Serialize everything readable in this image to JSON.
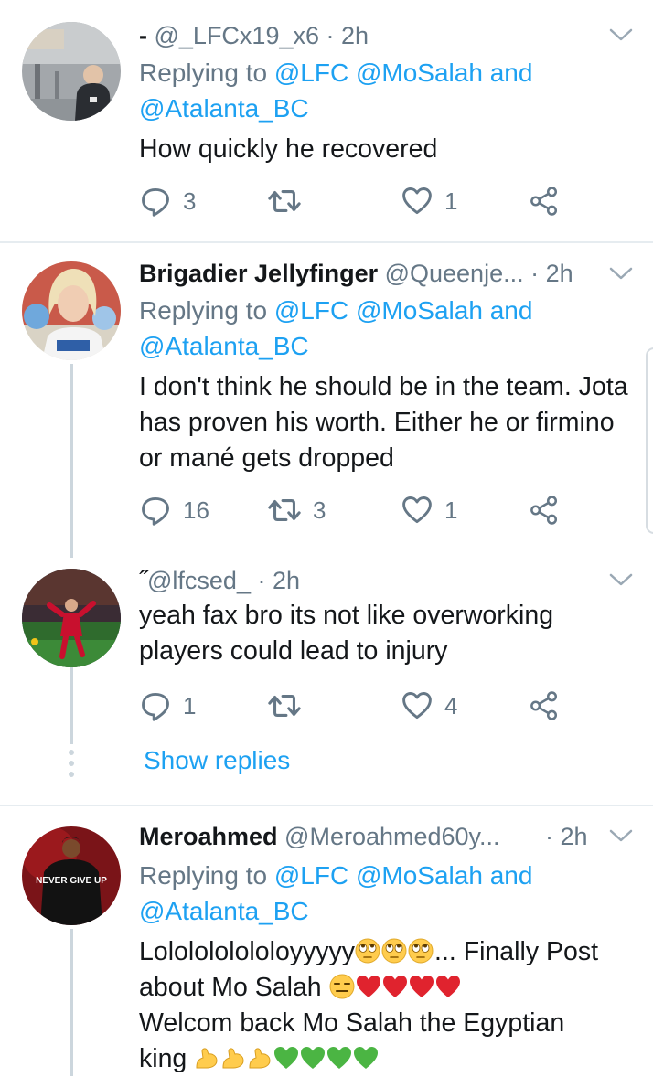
{
  "tweets": [
    {
      "display_name": "- ",
      "handle": "@_LFCx19_x6 · 2h",
      "reply_prefix": "Replying to ",
      "reply_targets": "@LFC @MoSalah and @Atalanta_BC",
      "text": "How quickly he recovered",
      "replies": "3",
      "retweets": "",
      "likes": "1"
    },
    {
      "display_name": "Brigadier Jellyfinger",
      "handle": " @Queenje... · 2h",
      "reply_prefix": "Replying to ",
      "reply_targets": "@LFC @MoSalah and @Atalanta_BC",
      "text": "I don't think he should be in the team. Jota has proven his worth. Either he or firmino or mané gets dropped",
      "replies": "16",
      "retweets": "3",
      "likes": "1"
    },
    {
      "display_name": "˝",
      "handle": "@lfcsed_ · 2h",
      "text": "yeah fax bro its not like overworking players could lead to injury",
      "replies": "1",
      "retweets": "",
      "likes": "4"
    },
    {
      "display_name": "Meroahmed",
      "handle": " @Meroahmed60y...",
      "time": " · 2h",
      "reply_prefix": "Replying to ",
      "reply_targets": "@LFC @MoSalah and @Atalanta_BC",
      "text_line1": "Lololololololoyyyyy",
      "text_line1_end": "... Finally Post",
      "text_line2": "about Mo Salah ",
      "text_line3": "Welcom back Mo Salah the Egyptian",
      "text_line4": "king "
    }
  ],
  "show_replies": "Show replies",
  "avatar_text": "NEVER GIVE UP",
  "colors": {
    "link": "#1da1f2",
    "secondary": "#657786",
    "divider": "#e6ecf0",
    "thread": "#ccd6dd"
  },
  "icons": [
    "reply-icon",
    "retweet-icon",
    "like-icon",
    "share-icon",
    "chevron-down-icon",
    "rolling-eyes-emoji",
    "expressionless-emoji",
    "red-heart-emoji",
    "flexed-biceps-emoji",
    "green-heart-emoji"
  ]
}
